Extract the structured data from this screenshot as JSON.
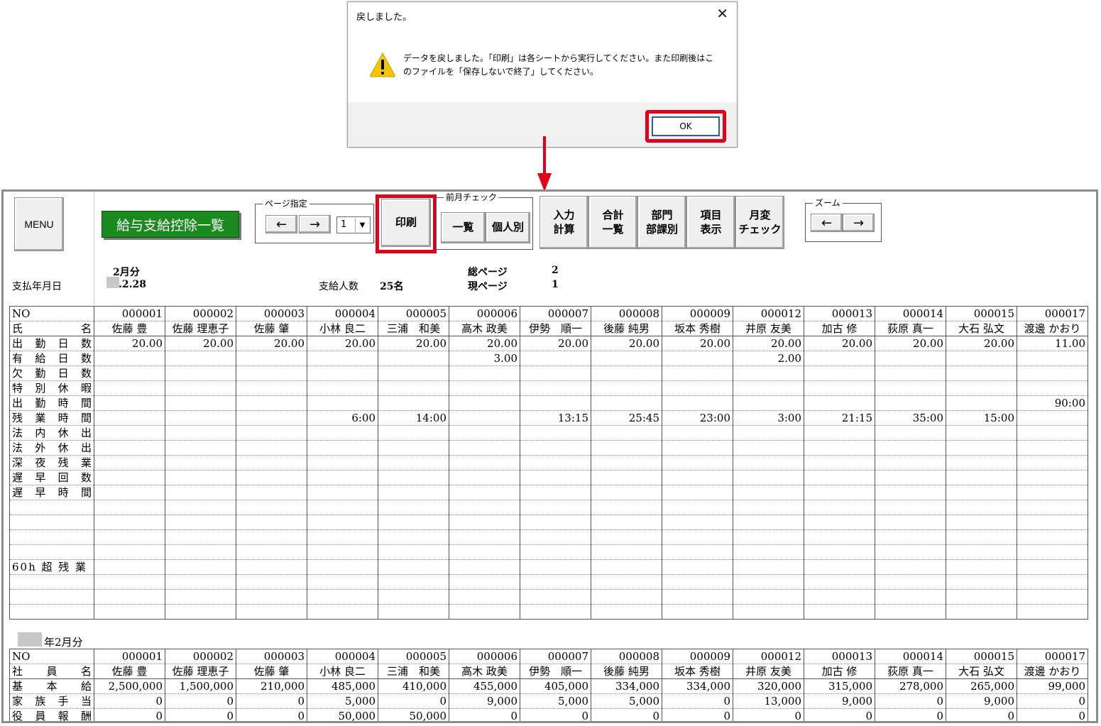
{
  "dialog": {
    "title": "戻しました。",
    "close": "✕",
    "message": "データを戻しました。「印刷」は各シートから実行してください。また印刷後はこのファイルを「保存しないで終了」してください。",
    "ok_label": "OK"
  },
  "toolbar": {
    "menu": "MENU",
    "sheet_title": "給与支給控除一覧",
    "page_group": {
      "legend": "ページ指定",
      "prev": "←",
      "next": "→",
      "page_value": "1"
    },
    "print": "印刷",
    "prev_month_group": {
      "legend": "前月チェック",
      "list": "一覧",
      "individual": "個人別"
    },
    "input_calc": "入力\n計算",
    "total_list": "合計\n一覧",
    "dept": "部門\n部課別",
    "items": "項目\n表示",
    "monthly_change": "月変\nチェック",
    "zoom_group": {
      "legend": "ズーム",
      "prev": "←",
      "next": "→"
    }
  },
  "info": {
    "month": "2月分",
    "pay_date_label": "支払年月日",
    "pay_date": ".2.28",
    "count_label": "支給人数",
    "count_value": "25名",
    "total_pages_label": "総ページ",
    "total_pages": "2",
    "current_page_label": "現ページ",
    "current_page": "1",
    "second_section_title": "年2月分"
  },
  "employees": [
    {
      "no": "000001",
      "name": "佐藤 豊"
    },
    {
      "no": "000002",
      "name": "佐藤 理恵子"
    },
    {
      "no": "000003",
      "name": "佐藤 肇"
    },
    {
      "no": "000004",
      "name": "小林 良二"
    },
    {
      "no": "000005",
      "name": "三浦　和美"
    },
    {
      "no": "000006",
      "name": "高木 政美"
    },
    {
      "no": "000007",
      "name": "伊勢　順一"
    },
    {
      "no": "000008",
      "name": "後藤 純男"
    },
    {
      "no": "000009",
      "name": "坂本 秀樹"
    },
    {
      "no": "000012",
      "name": "井原 友美"
    },
    {
      "no": "000013",
      "name": "加古 修"
    },
    {
      "no": "000014",
      "name": "荻原 真一"
    },
    {
      "no": "000015",
      "name": "大石 弘文"
    },
    {
      "no": "000017",
      "name": "渡邊 かおり"
    }
  ],
  "attendance": {
    "no_label": "NO",
    "name_label": "氏　　名",
    "rows": [
      {
        "label": "出勤日数",
        "values": [
          "20.00",
          "20.00",
          "20.00",
          "20.00",
          "20.00",
          "20.00",
          "20.00",
          "20.00",
          "20.00",
          "20.00",
          "20.00",
          "20.00",
          "20.00",
          "11.00"
        ]
      },
      {
        "label": "有給日数",
        "values": [
          "",
          "",
          "",
          "",
          "",
          "3.00",
          "",
          "",
          "",
          "2.00",
          "",
          "",
          "",
          ""
        ]
      },
      {
        "label": "欠勤日数",
        "values": [
          "",
          "",
          "",
          "",
          "",
          "",
          "",
          "",
          "",
          "",
          "",
          "",
          "",
          ""
        ]
      },
      {
        "label": "特別休暇",
        "values": [
          "",
          "",
          "",
          "",
          "",
          "",
          "",
          "",
          "",
          "",
          "",
          "",
          "",
          ""
        ]
      },
      {
        "label": "出勤時間",
        "values": [
          "",
          "",
          "",
          "",
          "",
          "",
          "",
          "",
          "",
          "",
          "",
          "",
          "",
          "90:00"
        ]
      },
      {
        "label": "残業時間",
        "values": [
          "",
          "",
          "",
          "6:00",
          "14:00",
          "",
          "13:15",
          "25:45",
          "23:00",
          "3:00",
          "21:15",
          "35:00",
          "15:00",
          ""
        ]
      },
      {
        "label": "法内休出",
        "values": [
          "",
          "",
          "",
          "",
          "",
          "",
          "",
          "",
          "",
          "",
          "",
          "",
          "",
          ""
        ]
      },
      {
        "label": "法外休出",
        "values": [
          "",
          "",
          "",
          "",
          "",
          "",
          "",
          "",
          "",
          "",
          "",
          "",
          "",
          ""
        ]
      },
      {
        "label": "深夜残業",
        "values": [
          "",
          "",
          "",
          "",
          "",
          "",
          "",
          "",
          "",
          "",
          "",
          "",
          "",
          ""
        ]
      },
      {
        "label": "遅早回数",
        "values": [
          "",
          "",
          "",
          "",
          "",
          "",
          "",
          "",
          "",
          "",
          "",
          "",
          "",
          ""
        ]
      },
      {
        "label": "遅早時間",
        "values": [
          "",
          "",
          "",
          "",
          "",
          "",
          "",
          "",
          "",
          "",
          "",
          "",
          "",
          ""
        ]
      },
      {
        "label": "",
        "values": [
          "",
          "",
          "",
          "",
          "",
          "",
          "",
          "",
          "",
          "",
          "",
          "",
          "",
          ""
        ]
      },
      {
        "label": "",
        "values": [
          "",
          "",
          "",
          "",
          "",
          "",
          "",
          "",
          "",
          "",
          "",
          "",
          "",
          ""
        ]
      },
      {
        "label": "",
        "values": [
          "",
          "",
          "",
          "",
          "",
          "",
          "",
          "",
          "",
          "",
          "",
          "",
          "",
          ""
        ]
      },
      {
        "label": "",
        "values": [
          "",
          "",
          "",
          "",
          "",
          "",
          "",
          "",
          "",
          "",
          "",
          "",
          "",
          ""
        ]
      },
      {
        "label": "60h 超 残 業",
        "values": [
          "",
          "",
          "",
          "",
          "",
          "",
          "",
          "",
          "",
          "",
          "",
          "",
          "",
          ""
        ]
      },
      {
        "label": "",
        "values": [
          "",
          "",
          "",
          "",
          "",
          "",
          "",
          "",
          "",
          "",
          "",
          "",
          "",
          ""
        ]
      },
      {
        "label": "",
        "values": [
          "",
          "",
          "",
          "",
          "",
          "",
          "",
          "",
          "",
          "",
          "",
          "",
          "",
          ""
        ]
      },
      {
        "label": "",
        "values": [
          "",
          "",
          "",
          "",
          "",
          "",
          "",
          "",
          "",
          "",
          "",
          "",
          "",
          ""
        ]
      }
    ]
  },
  "salary": {
    "no_label": "NO",
    "name_label": "社　員　名",
    "rows": [
      {
        "label": "基本給",
        "values": [
          "2,500,000",
          "1,500,000",
          "210,000",
          "485,000",
          "410,000",
          "455,000",
          "405,000",
          "334,000",
          "334,000",
          "320,000",
          "315,000",
          "278,000",
          "265,000",
          "99,000"
        ]
      },
      {
        "label": "家族手当",
        "values": [
          "0",
          "0",
          "0",
          "5,000",
          "0",
          "9,000",
          "5,000",
          "5,000",
          "0",
          "13,000",
          "9,000",
          "0",
          "9,000",
          "0"
        ]
      },
      {
        "label": "役員報酬",
        "values": [
          "0",
          "0",
          "0",
          "50,000",
          "50,000",
          "0",
          "0",
          "0",
          "0",
          "0",
          "0",
          "0",
          "0",
          "0"
        ]
      }
    ]
  },
  "colors": {
    "highlight": "#e0001b",
    "title_green": "#1a8a1f"
  }
}
